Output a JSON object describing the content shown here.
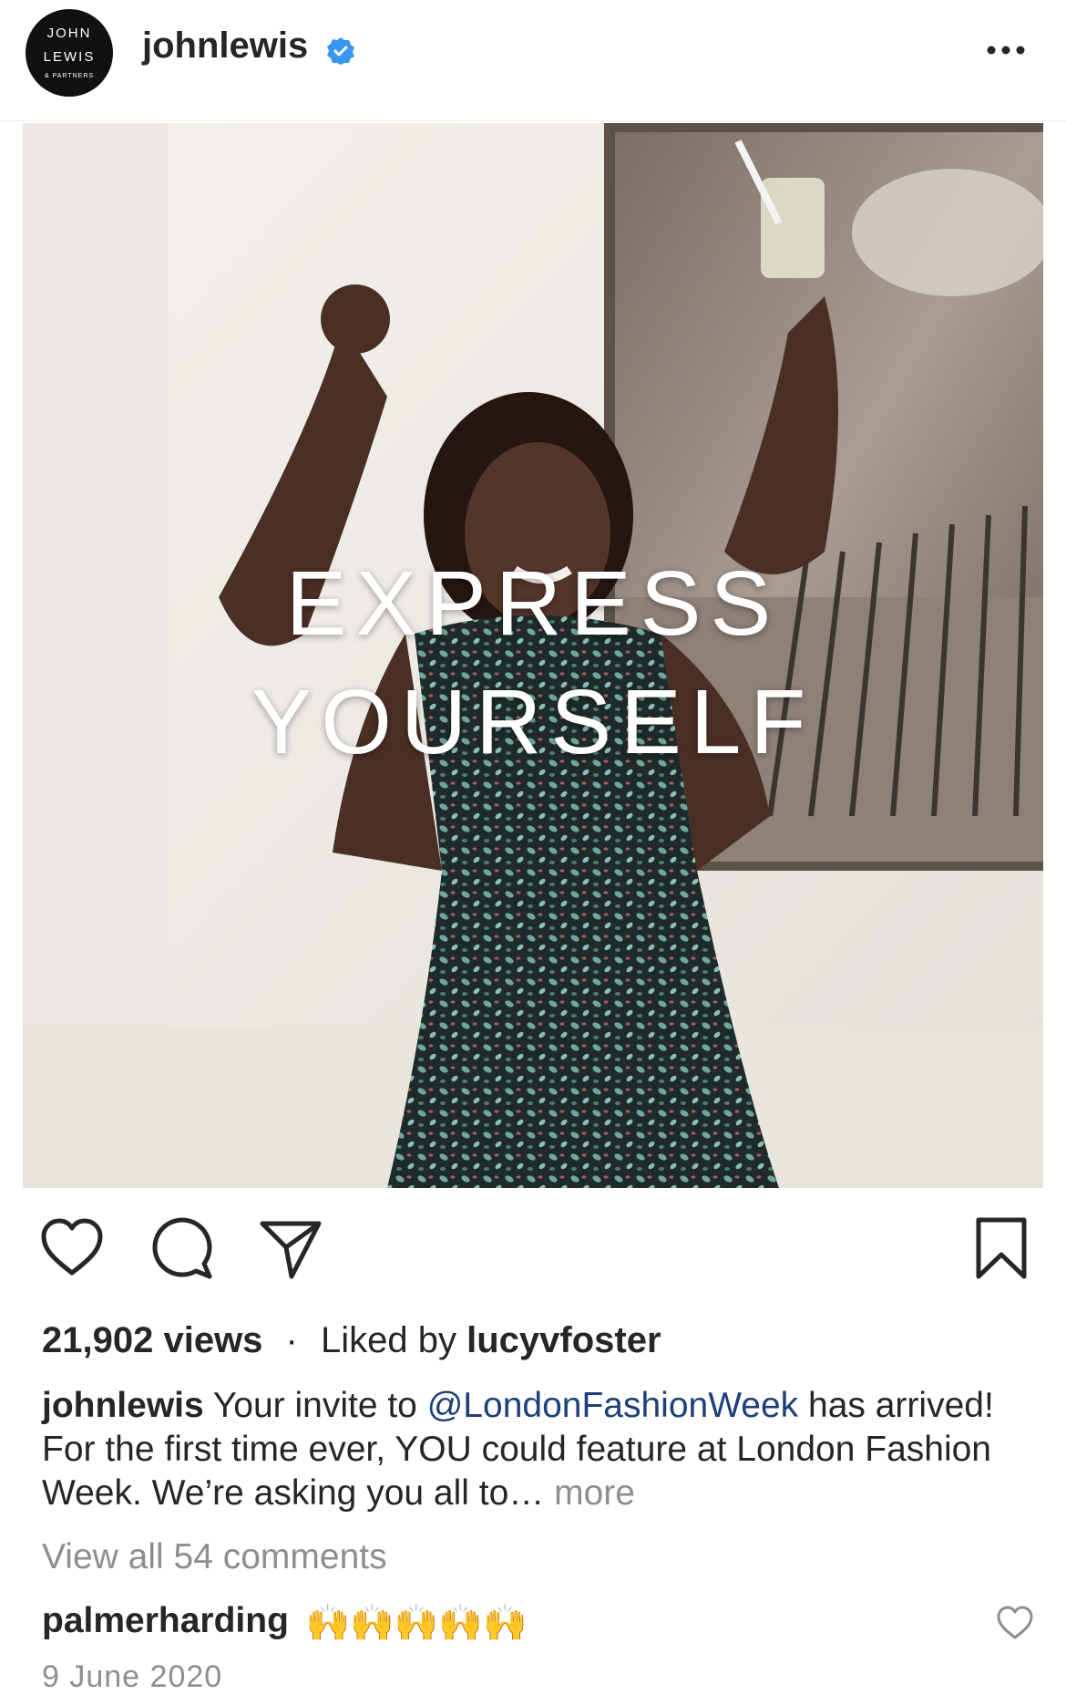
{
  "header": {
    "avatar": {
      "line1": "JOHN",
      "line2": "LEWIS",
      "line3": "& PARTNERS"
    },
    "username": "johnlewis",
    "verified_color": "#3897f0",
    "more_icon": "more-horizontal-icon"
  },
  "media": {
    "overlay_line1": "EXPRESS",
    "overlay_line2": "YOURSELF"
  },
  "actions": {
    "icons": [
      "heart-icon",
      "comment-icon",
      "share-icon",
      "bookmark-icon"
    ]
  },
  "stats": {
    "views": "21,902 views",
    "separator": "·",
    "liked_by_prefix": "Liked by",
    "liked_by_user": "lucyvfoster"
  },
  "caption": {
    "user": "johnlewis",
    "text_before_mention": " Your invite to ",
    "mention": "@LondonFashionWeek",
    "text_after_mention": " has arrived! For the first time ever, YOU could feature at London Fashion Week. We’re asking you all to…",
    "more": " more",
    "mention_color": "#1d3f7a"
  },
  "comments": {
    "view_all": "View all 54 comments",
    "top_comment_user": "palmerharding",
    "top_comment_emoji": "🙌🙌🙌🙌🙌"
  },
  "date": "9 June 2020"
}
